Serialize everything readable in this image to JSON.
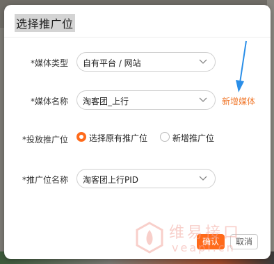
{
  "dialog": {
    "title": "选择推广位",
    "media_type": {
      "label": "*媒体类型",
      "value": "自有平台 / 网站"
    },
    "media_name": {
      "label": "*媒体名称",
      "value": "淘客团_上行",
      "add_link": "新增媒体"
    },
    "placement": {
      "label": "*投放推广位",
      "options": [
        {
          "label": "选择原有推广位",
          "selected": true
        },
        {
          "label": "新增推广位",
          "selected": false
        }
      ]
    },
    "placement_name": {
      "label": "*推广位名称",
      "value": "淘客团上行PID"
    },
    "confirm_label": "确认",
    "cancel_label": "取消"
  },
  "watermark": {
    "top": "维易接口",
    "bottom": "veapi.cn"
  },
  "colors": {
    "accent": "#ff6a1a",
    "link": "#f0782c",
    "arrow": "#2a8ee8"
  }
}
